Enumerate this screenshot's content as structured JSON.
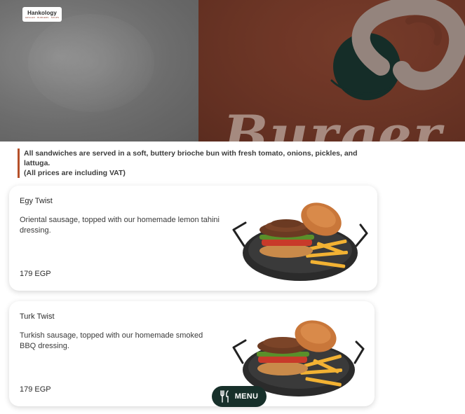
{
  "brand": {
    "name": "Hankology",
    "tagline": "GRILLED · BURGERS · SOUPS"
  },
  "hero": {
    "word": "Burger"
  },
  "notice": {
    "line1": "All sandwiches are served in a soft, buttery brioche bun with fresh tomato, onions, pickles, and lattuga.",
    "line2": "(All prices are including VAT)",
    "accent_color": "#b5502a"
  },
  "items": [
    {
      "name": "Egy Twist",
      "description": "Oriental sausage, topped with our homemade lemon tahini dressing.",
      "price": "179 EGP"
    },
    {
      "name": "Turk Twist",
      "description": "Turkish sausage, topped with our homemade smoked BBQ dressing.",
      "price": "179 EGP"
    }
  ],
  "menu_button": {
    "label": "MENU",
    "icon": "cutlery-icon",
    "color": "#17302a"
  }
}
